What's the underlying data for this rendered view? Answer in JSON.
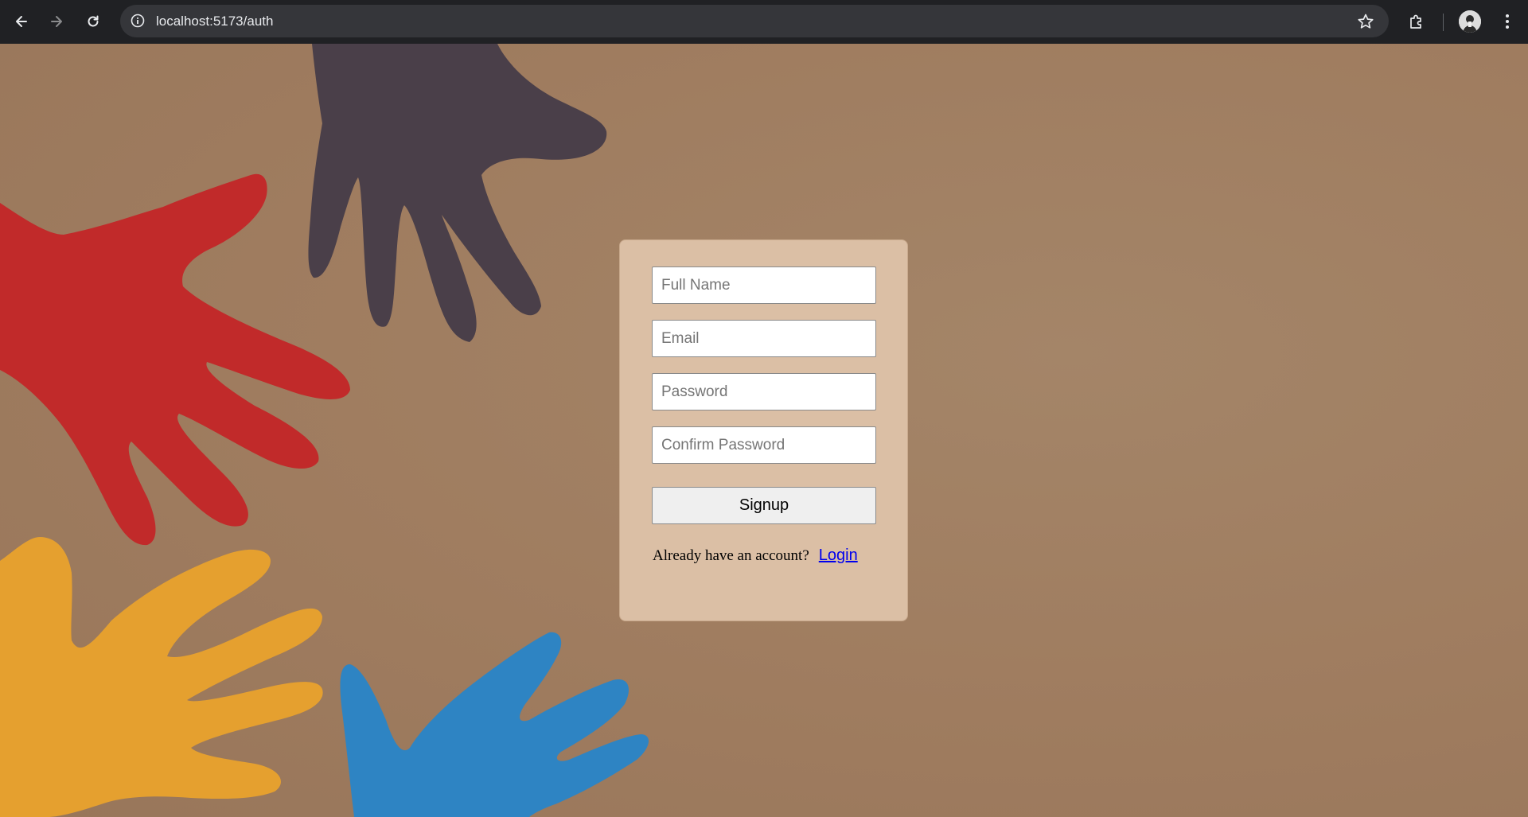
{
  "browser": {
    "url": "localhost:5173/auth",
    "back_icon": "arrow-left-icon",
    "forward_icon": "arrow-right-icon",
    "reload_icon": "reload-icon",
    "site_info_icon": "info-icon",
    "bookmark_icon": "star-icon",
    "extensions_icon": "puzzle-icon",
    "menu_icon": "kebab-menu-icon"
  },
  "background": {
    "description_icons": [
      "red-hand",
      "dark-purple-hand",
      "orange-hand",
      "blue-hand"
    ],
    "colors": {
      "backdrop": "#a07e62",
      "red_hand": "#c12a2a",
      "purple_hand": "#4a3f49",
      "orange_hand": "#e5a02f",
      "blue_hand": "#2e84c3"
    }
  },
  "auth_form": {
    "card_color": "#dbbfa5",
    "fields": {
      "full_name_placeholder": "Full Name",
      "email_placeholder": "Email",
      "password_placeholder": "Password",
      "confirm_password_placeholder": "Confirm Password"
    },
    "signup_label": "Signup",
    "login_prompt": "Already have an account?",
    "login_link": "Login"
  }
}
